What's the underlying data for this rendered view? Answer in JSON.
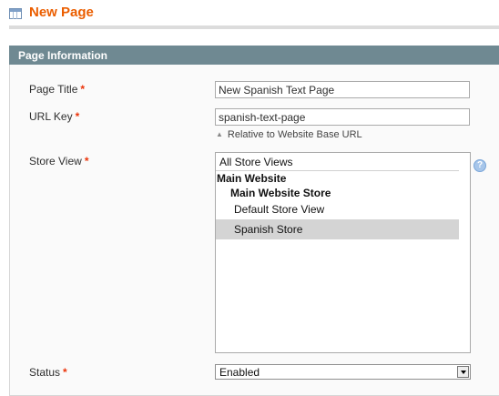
{
  "header": {
    "title": "New Page"
  },
  "fieldset": {
    "legend": "Page Information"
  },
  "fields": {
    "page_title": {
      "label": "Page Title",
      "required": "*",
      "value": "New Spanish Text Page"
    },
    "url_key": {
      "label": "URL Key",
      "required": "*",
      "value": "spanish-text-page",
      "note": "Relative to Website Base URL"
    },
    "store_view": {
      "label": "Store View",
      "required": "*",
      "options": {
        "all": "All Store Views",
        "website": "Main Website",
        "store": "Main Website Store",
        "default_view": "Default Store View",
        "spanish_view": "Spanish Store"
      },
      "selected": "Spanish Store",
      "help_icon": "?"
    },
    "status": {
      "label": "Status",
      "required": "*",
      "value": "Enabled"
    }
  }
}
